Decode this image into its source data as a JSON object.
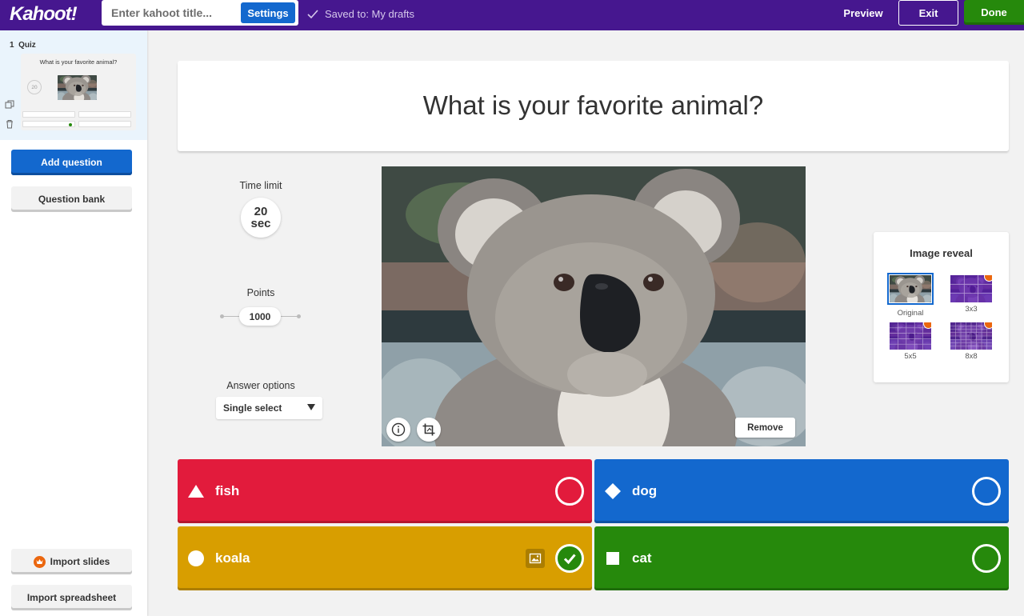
{
  "colors": {
    "brand": "#46178f",
    "primary_blue": "#1368ce",
    "done_green": "#26890c",
    "answer_red": "#e21b3c",
    "answer_blue": "#1368ce",
    "answer_gold": "#d89e00",
    "answer_green": "#26890c"
  },
  "topbar": {
    "logo": "Kahoot!",
    "title_placeholder": "Enter kahoot title...",
    "settings_label": "Settings",
    "saved_status": "Saved to: My drafts",
    "preview_label": "Preview",
    "exit_label": "Exit",
    "done_label": "Done"
  },
  "sidebar": {
    "slide": {
      "number": "1",
      "type": "Quiz",
      "question": "What is your favorite animal?",
      "time": "20"
    },
    "add_question": "Add question",
    "question_bank": "Question bank",
    "import_slides": "Import slides",
    "import_spreadsheet": "Import spreadsheet"
  },
  "question": {
    "title": "What is your favorite animal?"
  },
  "settings_panel": {
    "time_limit_label": "Time limit",
    "time_value": "20",
    "time_unit": "sec",
    "points_label": "Points",
    "points_value": "1000",
    "answer_options_label": "Answer options",
    "answer_options_value": "Single select"
  },
  "media": {
    "remove_label": "Remove",
    "info_icon": "info-icon",
    "crop_icon": "crop-icon"
  },
  "image_reveal": {
    "title": "Image reveal",
    "options": [
      {
        "label": "Original",
        "selected": true,
        "premium": false
      },
      {
        "label": "3x3",
        "selected": false,
        "premium": true
      },
      {
        "label": "5x5",
        "selected": false,
        "premium": true
      },
      {
        "label": "8x8",
        "selected": false,
        "premium": true
      }
    ]
  },
  "answers": [
    {
      "text": "fish",
      "shape": "triangle",
      "correct": false
    },
    {
      "text": "dog",
      "shape": "diamond",
      "correct": false
    },
    {
      "text": "koala",
      "shape": "circle",
      "correct": true
    },
    {
      "text": "cat",
      "shape": "square",
      "correct": false
    }
  ]
}
